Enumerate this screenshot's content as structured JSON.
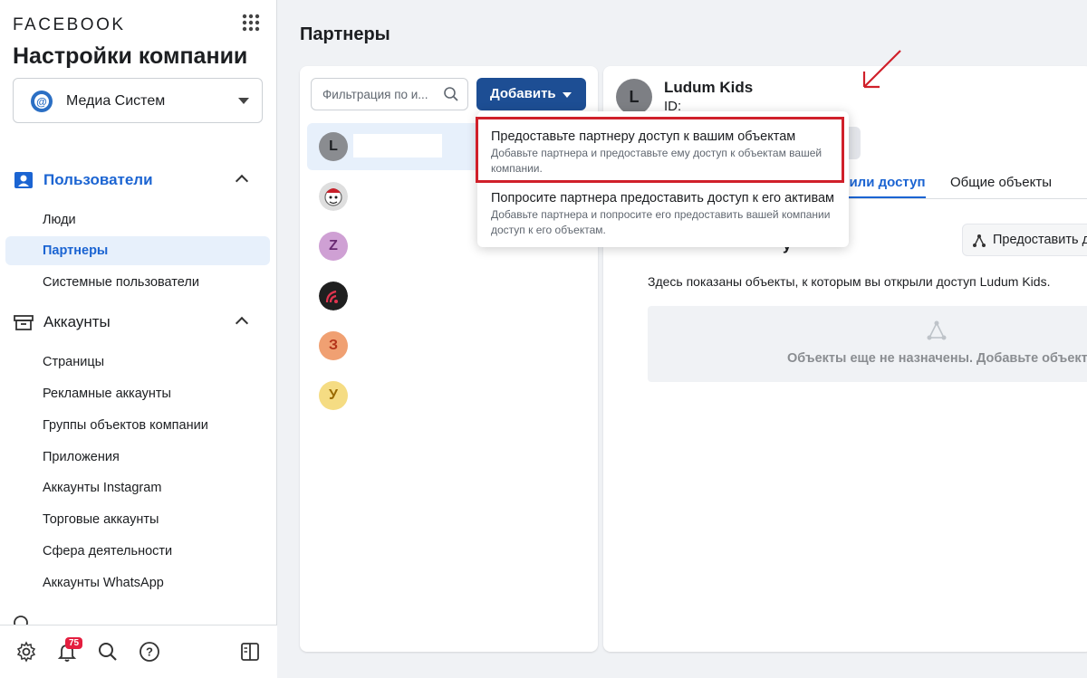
{
  "sidebar": {
    "brand": "FACEBOOK",
    "title": "Настройки компании",
    "business_selector": {
      "name": "Медиа Систем"
    },
    "sections": [
      {
        "label": "Пользователи",
        "icon": "users-icon",
        "items": [
          "Люди",
          "Партнеры",
          "Системные пользователи"
        ]
      },
      {
        "label": "Аккаунты",
        "icon": "accounts-box-icon",
        "items": [
          "Страницы",
          "Рекламные аккаунты",
          "Группы объектов компании",
          "Приложения",
          "Аккаунты Instagram",
          "Торговые аккаунты",
          "Сфера деятельности",
          "Аккаунты WhatsApp"
        ]
      }
    ],
    "active_item": "Партнеры",
    "footer": {
      "notification_count": "75",
      "icons": [
        "settings-icon",
        "notifications-icon",
        "search-icon",
        "help-icon",
        "panel-toggle-icon"
      ]
    }
  },
  "main": {
    "page_title": "Партнеры",
    "filter": {
      "placeholder": "Фильтрация по и..."
    },
    "add_button": "Добавить",
    "partners": [
      {
        "initial": "L",
        "color": "#8a8c90"
      },
      {
        "initial": "",
        "color": "#e9e9e9"
      },
      {
        "initial": "Z",
        "color": "#cfa0d4"
      },
      {
        "initial": "",
        "color": "#1f1f1f"
      },
      {
        "initial": "З",
        "color": "#f0a072"
      },
      {
        "initial": "У",
        "color": "#f5dc83"
      }
    ],
    "dropdown": [
      {
        "title": "Предоставьте партнеру доступ к вашим объектам",
        "description": "Добавьте партнера и предоставьте ему доступ к объектам вашей компании."
      },
      {
        "title": "Попросите партнера предоставить доступ к его активам",
        "description": "Добавьте партнера и попросите его предоставить вашей компании доступ к его объектам."
      }
    ],
    "detail": {
      "avatar_initial": "L",
      "name": "Ludum Kids",
      "id_label": "ID:",
      "tab_active": "зили доступ",
      "tab_other": "Общие объекты",
      "share_button": "Предоставить д",
      "behind_fragment": "у",
      "description": "Здесь показаны объекты, к которым вы открыли доступ Ludum Kids.",
      "empty_message": "Объекты еще не назначены. Добавьте объект."
    }
  },
  "colors": {
    "accent": "#1b64d2",
    "button": "#1d4e94",
    "highlight": "#d0202a"
  }
}
